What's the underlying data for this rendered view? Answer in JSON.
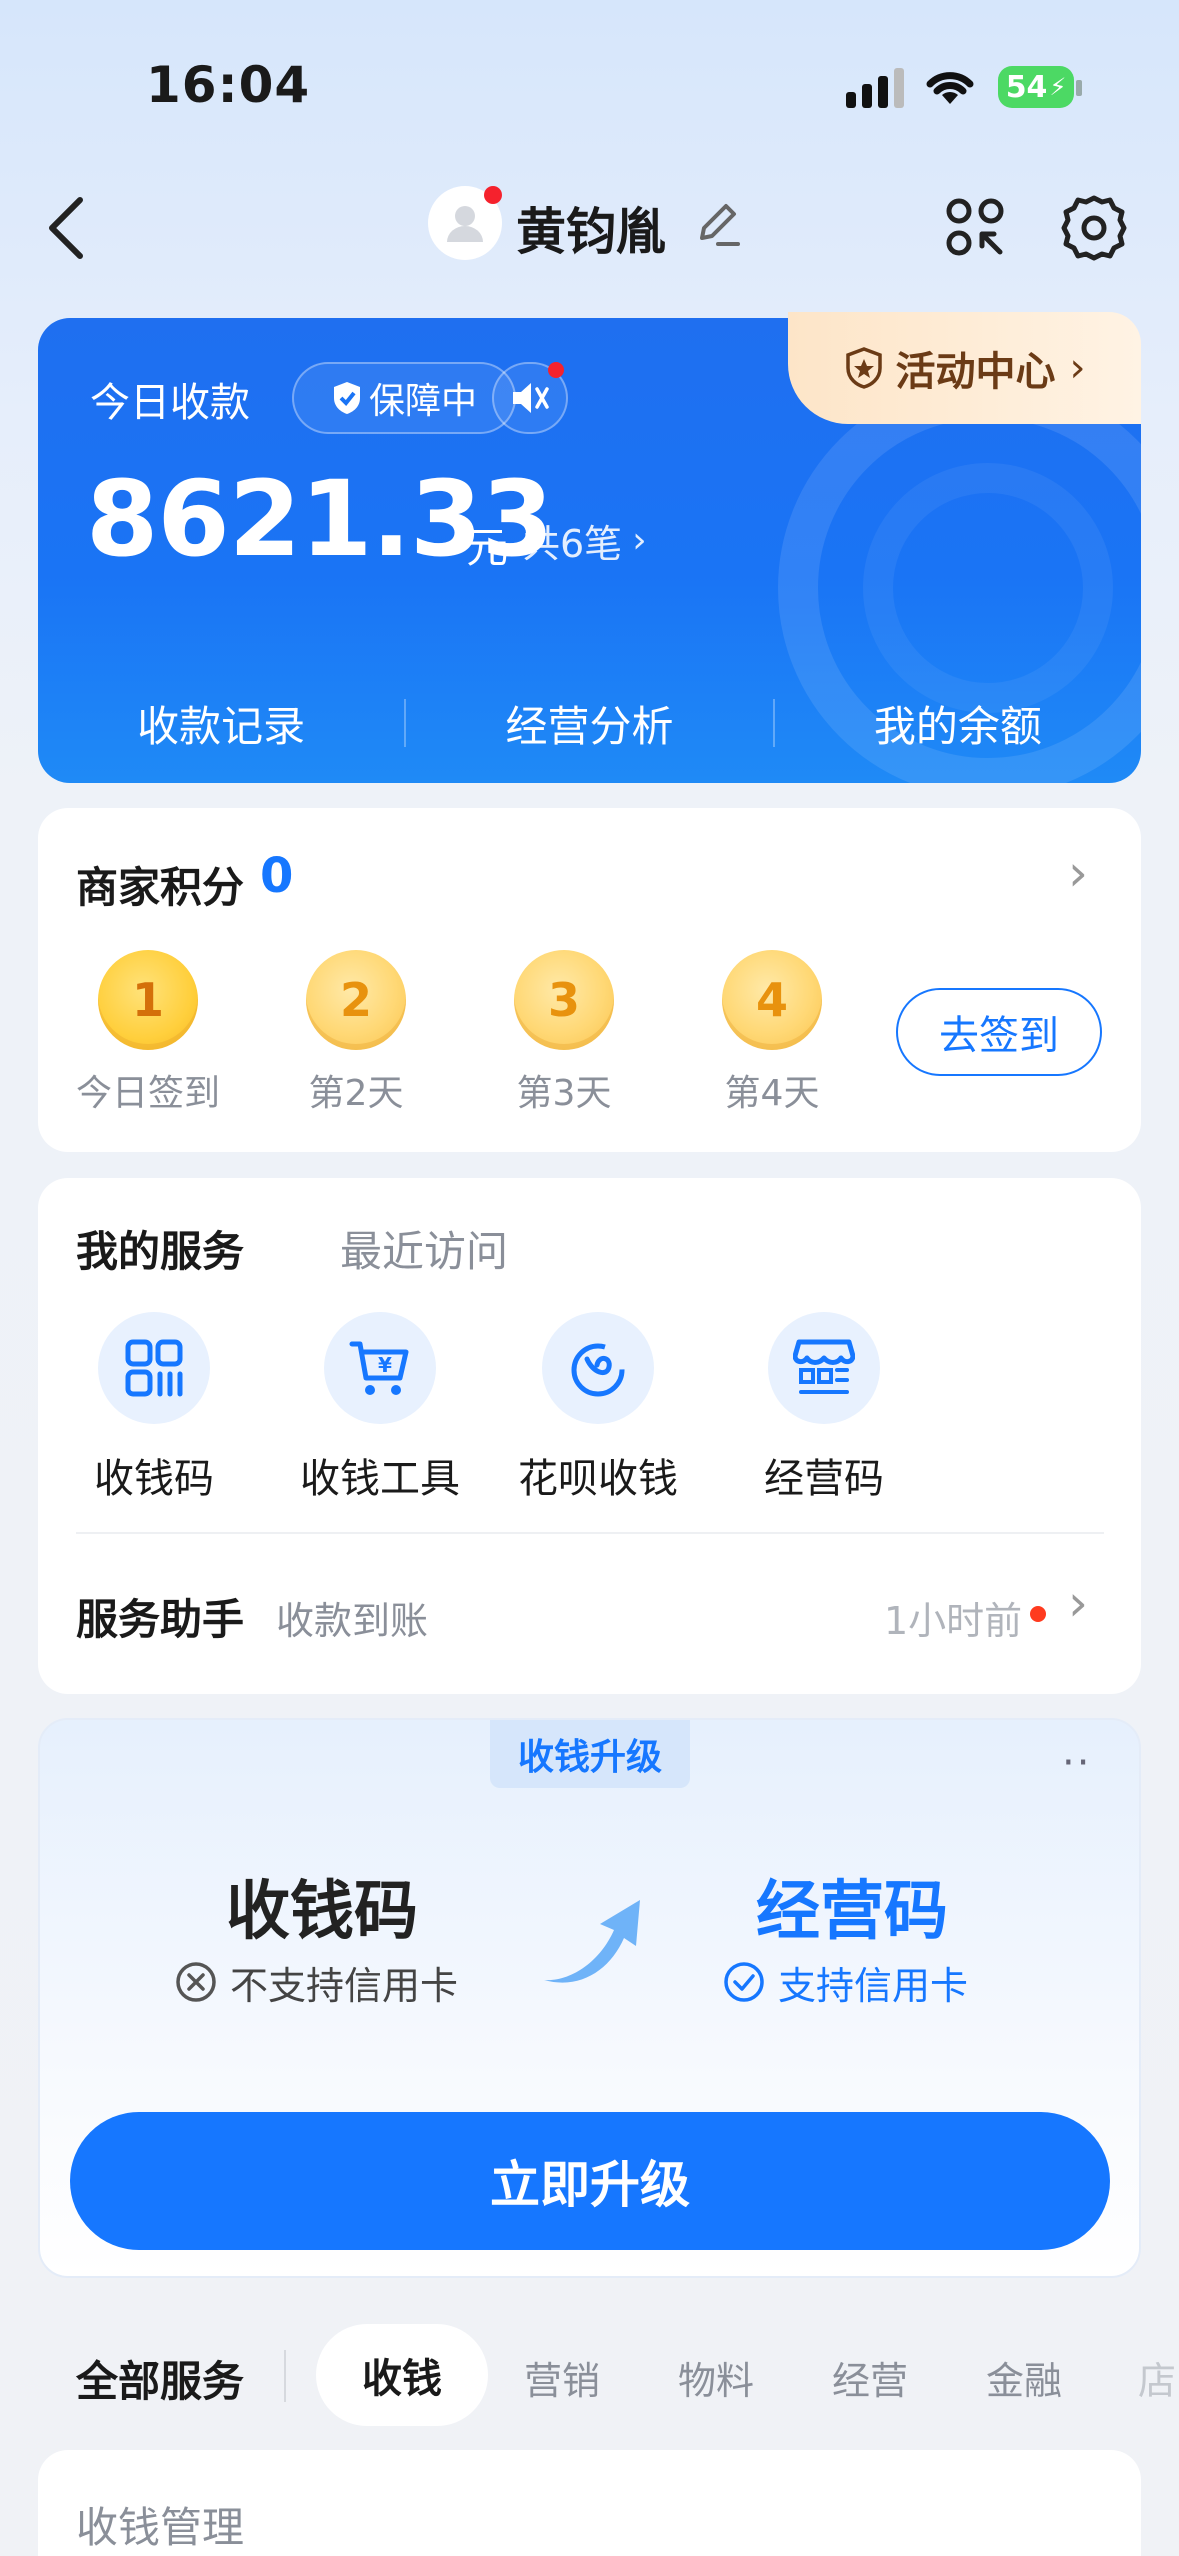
{
  "status_bar": {
    "time": "16:04",
    "battery": "54"
  },
  "header": {
    "user_name": "黄钧胤"
  },
  "today_card": {
    "title": "今日收款",
    "protection_badge": "保障中",
    "activity_center": "活动中心",
    "amount": "8621.33",
    "unit": "元",
    "count_text": "共6笔",
    "actions": [
      "收款记录",
      "经营分析",
      "我的余额"
    ]
  },
  "points": {
    "title": "商家积分",
    "value": "0",
    "days": [
      {
        "num": "1",
        "label": "今日签到"
      },
      {
        "num": "2",
        "label": "第2天"
      },
      {
        "num": "3",
        "label": "第3天"
      },
      {
        "num": "4",
        "label": "第4天"
      }
    ],
    "checkin_button": "去签到"
  },
  "services": {
    "tab_active": "我的服务",
    "tab_inactive": "最近访问",
    "items": [
      {
        "label": "收钱码",
        "icon": "qr-code-icon"
      },
      {
        "label": "收钱工具",
        "icon": "cart-yuan-icon"
      },
      {
        "label": "花呗收钱",
        "icon": "huabei-icon"
      },
      {
        "label": "经营码",
        "icon": "store-code-icon"
      }
    ],
    "assistant_title": "服务助手",
    "assistant_subtitle": "收款到账",
    "assistant_time": "1小时前"
  },
  "upgrade": {
    "badge": "收钱升级",
    "left_title": "收钱码",
    "left_sub": "不支持信用卡",
    "right_title": "经营码",
    "right_sub": "支持信用卡",
    "button": "立即升级"
  },
  "category_tabs": {
    "all_label": "全部服务",
    "tabs": [
      "收钱",
      "营销",
      "物料",
      "经营",
      "金融",
      "店"
    ]
  },
  "bottom_section": {
    "title": "收钱管理"
  },
  "colors": {
    "primary": "#1677ff",
    "accent_red": "#f5222d"
  }
}
